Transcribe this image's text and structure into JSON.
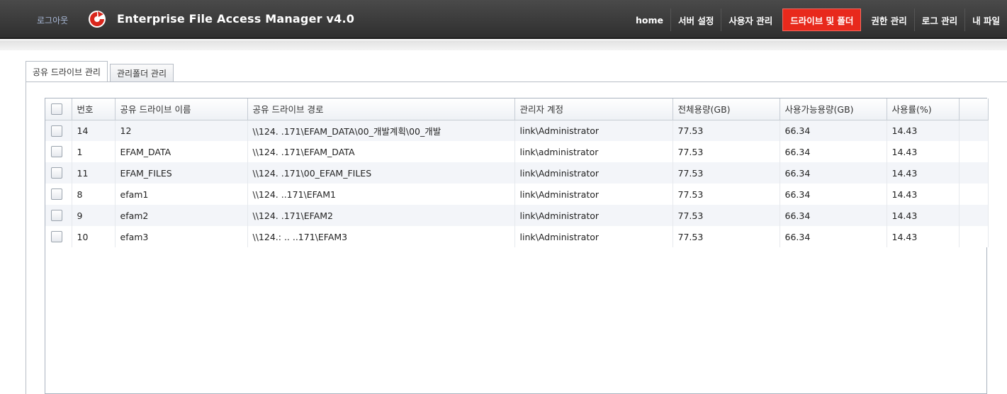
{
  "header": {
    "logout_label": "로그아웃",
    "logo_icon": "efam-logo-icon",
    "app_title": "Enterprise File Access Manager v4.0",
    "nav": [
      {
        "label": "home"
      },
      {
        "label": "서버 설정"
      },
      {
        "label": "사용자 관리"
      },
      {
        "label": "드라이브 및 폴더",
        "active": true
      },
      {
        "label": "권한 관리"
      },
      {
        "label": "로그 관리"
      },
      {
        "label": "내 파일"
      }
    ]
  },
  "tabs": [
    {
      "label": "공유 드라이브 관리",
      "active": true
    },
    {
      "label": "관리폴더 관리"
    }
  ],
  "table": {
    "headers": [
      "번호",
      "공유 드라이브 이름",
      "공유 드라이브 경로",
      "관리자 계정",
      "전체용량(GB)",
      "사용가능용량(GB)",
      "사용률(%)"
    ],
    "rows": [
      {
        "no": "14",
        "name": "12",
        "path": "\\\\124.       .171\\EFAM_DATA\\00_개발계획\\00_개발",
        "account": "link\\Administrator",
        "total": "77.53",
        "free": "66.34",
        "usage": "14.43"
      },
      {
        "no": "1",
        "name": "EFAM_DATA",
        "path": "\\\\124.       .171\\EFAM_DATA",
        "account": "link\\administrator",
        "total": "77.53",
        "free": "66.34",
        "usage": "14.43"
      },
      {
        "no": "11",
        "name": "EFAM_FILES",
        "path": "\\\\124.       .171\\00_EFAM_FILES",
        "account": "link\\Administrator",
        "total": "77.53",
        "free": "66.34",
        "usage": "14.43"
      },
      {
        "no": "8",
        "name": "efam1",
        "path": "\\\\124.       ..171\\EFAM1",
        "account": "link\\Administrator",
        "total": "77.53",
        "free": "66.34",
        "usage": "14.43"
      },
      {
        "no": "9",
        "name": "efam2",
        "path": "\\\\124.       .171\\EFAM2",
        "account": "link\\Administrator",
        "total": "77.53",
        "free": "66.34",
        "usage": "14.43"
      },
      {
        "no": "10",
        "name": "efam3",
        "path": "\\\\124.:     ..  ..171\\EFAM3",
        "account": "link\\Administrator",
        "total": "77.53",
        "free": "66.34",
        "usage": "14.43"
      }
    ]
  },
  "colors": {
    "accent": "#e8291c",
    "header_bg": "#3a3a3a",
    "logo_red": "#d9261c"
  }
}
